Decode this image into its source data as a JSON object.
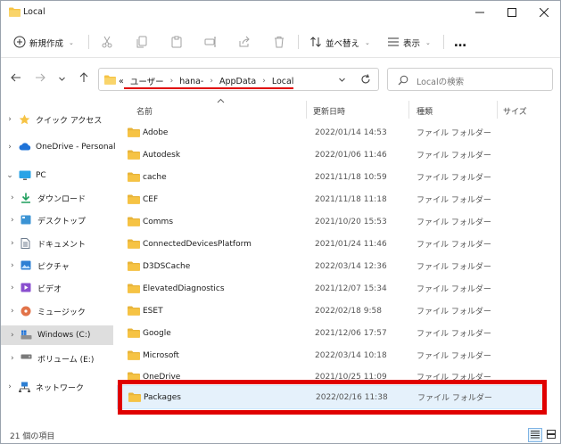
{
  "window": {
    "title": "Local"
  },
  "toolbar": {
    "new_label": "新規作成",
    "sort_label": "並べ替え",
    "view_label": "表示",
    "more_label": "…"
  },
  "address": {
    "overflow": "«",
    "crumbs": [
      "ユーザー",
      "hana-",
      "AppData",
      "Local"
    ],
    "separator": "›"
  },
  "search": {
    "placeholder": "Localの検索"
  },
  "nav": {
    "items": [
      {
        "label": "クイック アクセス"
      },
      {
        "label": "OneDrive - Personal"
      },
      {
        "label": "PC"
      },
      {
        "label": "ダウンロード"
      },
      {
        "label": "デスクトップ"
      },
      {
        "label": "ドキュメント"
      },
      {
        "label": "ピクチャ"
      },
      {
        "label": "ビデオ"
      },
      {
        "label": "ミュージック"
      },
      {
        "label": "Windows (C:)"
      },
      {
        "label": "ボリューム (E:)"
      },
      {
        "label": "ネットワーク"
      }
    ]
  },
  "columns": {
    "name": "名前",
    "date": "更新日時",
    "type": "種類",
    "size": "サイズ"
  },
  "files": [
    {
      "name": "Adobe",
      "date": "2022/01/14 14:53",
      "type": "ファイル フォルダー"
    },
    {
      "name": "Autodesk",
      "date": "2022/01/06 11:46",
      "type": "ファイル フォルダー"
    },
    {
      "name": "cache",
      "date": "2021/11/18 10:59",
      "type": "ファイル フォルダー"
    },
    {
      "name": "CEF",
      "date": "2021/11/18 11:18",
      "type": "ファイル フォルダー"
    },
    {
      "name": "Comms",
      "date": "2021/10/20 15:53",
      "type": "ファイル フォルダー"
    },
    {
      "name": "ConnectedDevicesPlatform",
      "date": "2021/01/24 11:46",
      "type": "ファイル フォルダー"
    },
    {
      "name": "D3DSCache",
      "date": "2022/03/14 12:36",
      "type": "ファイル フォルダー"
    },
    {
      "name": "ElevatedDiagnostics",
      "date": "2021/12/07 15:34",
      "type": "ファイル フォルダー"
    },
    {
      "name": "ESET",
      "date": "2022/02/18 9:58",
      "type": "ファイル フォルダー"
    },
    {
      "name": "Google",
      "date": "2021/12/06 17:57",
      "type": "ファイル フォルダー"
    },
    {
      "name": "Microsoft",
      "date": "2022/03/14 10:18",
      "type": "ファイル フォルダー"
    },
    {
      "name": "OneDrive",
      "date": "2021/10/25 11:09",
      "type": "ファイル フォルダー"
    },
    {
      "name": "Packages",
      "date": "2022/02/16 11:38",
      "type": "ファイル フォルダー"
    }
  ],
  "status": {
    "count_text": "21 個の項目"
  },
  "colors": {
    "highlight": "#e00000",
    "selection": "#e5f1fb",
    "folder": "#f6c344"
  }
}
